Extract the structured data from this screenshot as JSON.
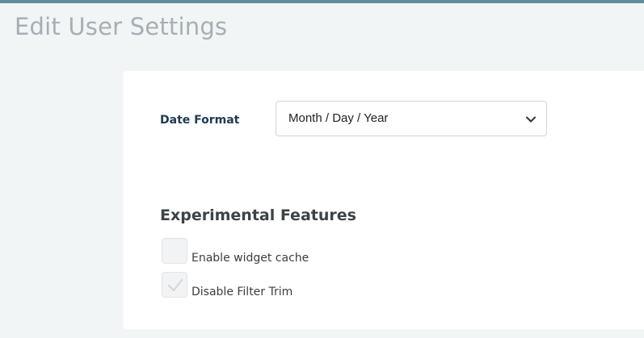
{
  "page": {
    "title": "Edit User Settings",
    "accent_color": "#5e8f99"
  },
  "settings": {
    "date_format": {
      "label": "Date Format",
      "selected": "Month / Day / Year",
      "icon": "chevron-down-icon"
    },
    "experimental": {
      "title": "Experimental Features",
      "options": [
        {
          "label": "Enable widget cache",
          "checked": false
        },
        {
          "label": "Disable Filter Trim",
          "checked": true
        }
      ]
    }
  }
}
